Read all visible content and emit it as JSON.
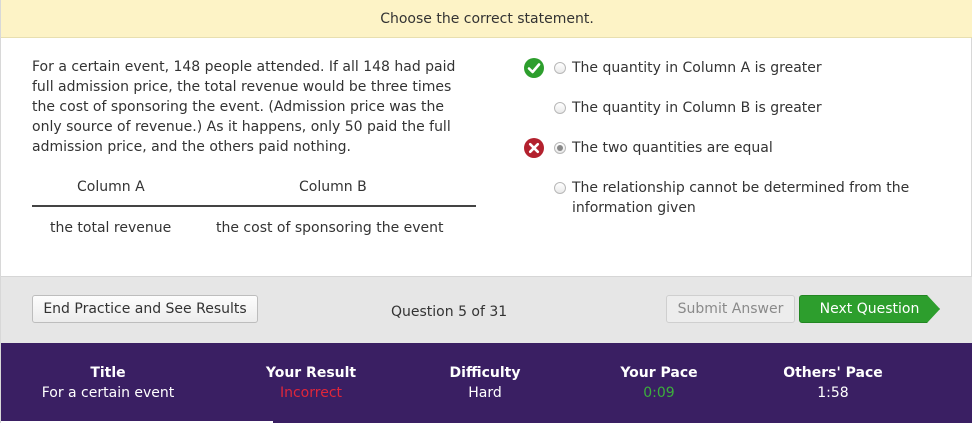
{
  "instruction": "Choose the correct statement.",
  "question": {
    "text": "For a certain event, 148 people attended. If all 148 had paid full admission price, the total revenue would be three times the cost of sponsoring the event. (Admission price was the only source of revenue.) As it happens, only 50 paid the full admission price, and the others paid nothing."
  },
  "columns": {
    "a_header": "Column A",
    "b_header": "Column B",
    "a_value": "the total revenue",
    "b_value": "the cost of sponsoring the event"
  },
  "choices": [
    {
      "label": "The quantity in Column A is greater",
      "selected": false,
      "mark": "correct-check-icon"
    },
    {
      "label": "The quantity in Column B is greater",
      "selected": false,
      "mark": ""
    },
    {
      "label": "The two quantities are equal",
      "selected": true,
      "mark": "incorrect-x-icon"
    },
    {
      "label": "The relationship cannot be determined from the information given",
      "selected": false,
      "mark": ""
    }
  ],
  "toolbar": {
    "end_label": "End Practice and See Results",
    "counter": "Question 5 of 31",
    "submit_label": "Submit Answer",
    "next_label": "Next Question"
  },
  "footer": {
    "title_head": "Title",
    "title_val": "For a certain event",
    "result_head": "Your Result",
    "result_val": "Incorrect",
    "difficulty_head": "Difficulty",
    "difficulty_val": "Hard",
    "pace_head": "Your Pace",
    "pace_val": "0:09",
    "others_head": "Others' Pace",
    "others_val": "1:58"
  },
  "colors": {
    "instruction_bg": "#fdf3c6",
    "footer_bg": "#3a1f63",
    "correct": "#2d9e2d",
    "incorrect": "#b3212e"
  }
}
